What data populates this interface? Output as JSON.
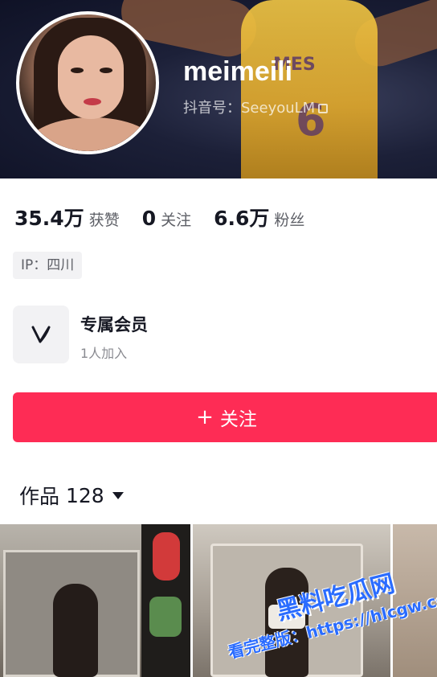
{
  "profile": {
    "username": "meimeili",
    "douyin_id": "抖音号：SeeyouLM"
  },
  "stats": [
    {
      "value": "35.4万",
      "label": "获赞"
    },
    {
      "value": "0",
      "label": "关注"
    },
    {
      "value": "6.6万",
      "label": "粉丝"
    }
  ],
  "ip": "IP：四川",
  "membership": {
    "title": "专属会员",
    "subtitle": "1人加入",
    "icon": "v-logo-icon"
  },
  "follow_button": {
    "plus": "+",
    "label": "关注"
  },
  "works": {
    "label": "作品",
    "count": "128"
  },
  "header_image": {
    "jersey_text": "MES",
    "jersey_number": "6"
  },
  "watermark": {
    "line1": "黑料吃瓜网",
    "line2": "看完整版：https://hlcgw.co"
  },
  "colors": {
    "accent": "#fe2c55",
    "watermark": "#2a6cff"
  }
}
